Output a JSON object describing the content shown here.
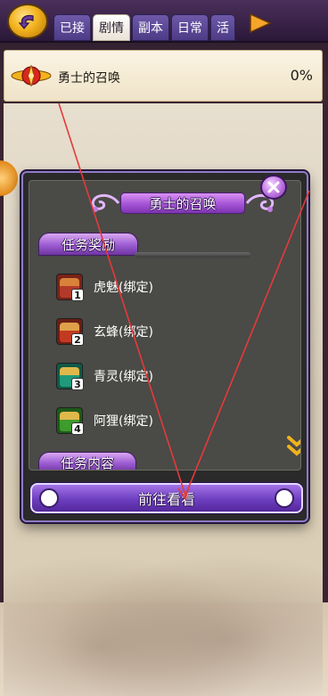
{
  "header": {
    "tabs": [
      {
        "label": "已接",
        "active": false
      },
      {
        "label": "剧情",
        "active": true
      },
      {
        "label": "副本",
        "active": false
      },
      {
        "label": "日常",
        "active": false
      },
      {
        "label": "活",
        "active": false
      }
    ]
  },
  "quest": {
    "name": "勇士的召唤",
    "progress": "0%"
  },
  "dialog": {
    "title": "勇士的召唤",
    "rewards_label": "任务奖励",
    "content_label": "任务内容",
    "rewards": [
      {
        "name": "虎魅(绑定)",
        "badge": "1",
        "color": "#b23a2a"
      },
      {
        "name": "玄蜂(绑定)",
        "badge": "2",
        "color": "#c23a22"
      },
      {
        "name": "青灵(绑定)",
        "badge": "3",
        "color": "#1f9a7a"
      },
      {
        "name": "阿狸(绑定)",
        "badge": "4",
        "color": "#3e9b2e"
      }
    ],
    "go_button": "前往看看"
  },
  "colors": {
    "accent_purple": "#8f5bd1",
    "gold": "#f2b21d",
    "trace_red": "#e53a3a"
  }
}
